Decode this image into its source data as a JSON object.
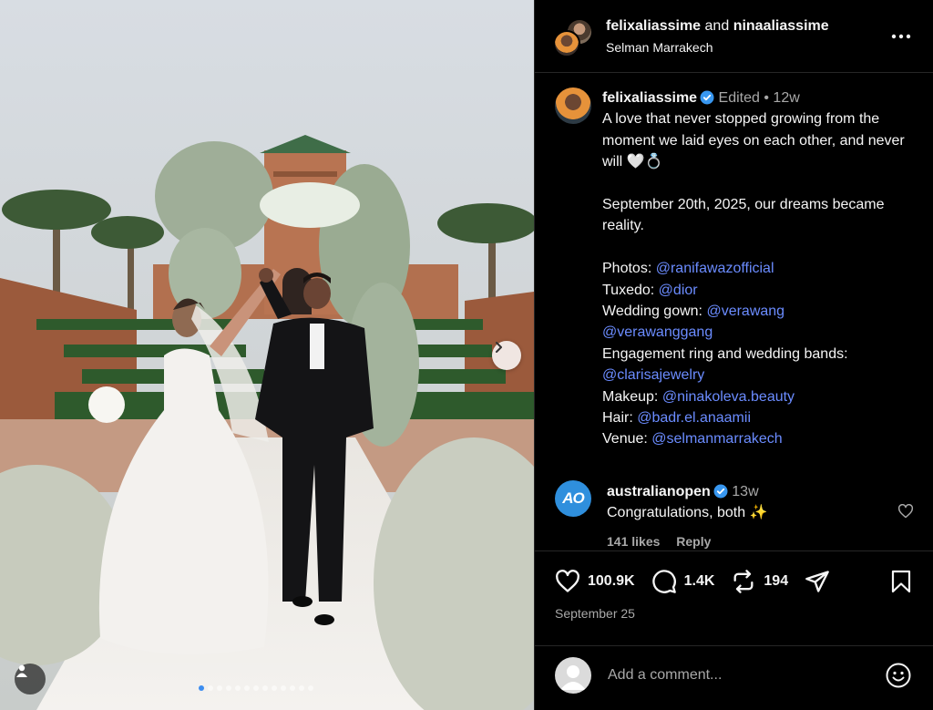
{
  "post": {
    "header": {
      "user1": "felixaliassime",
      "conjunction": "and",
      "user2": "ninaaliassime",
      "location": "Selman Marrakech"
    },
    "caption": {
      "username": "felixaliassime",
      "edited": "Edited",
      "separator": "•",
      "time": "12w",
      "line1": "A love that never stopped growing from the moment we laid eyes on each other, and never will 🤍💍",
      "line2": "September 20th, 2025, our dreams became reality.",
      "credits": [
        {
          "label": "Photos:",
          "handle": "@ranifawazofficial"
        },
        {
          "label": "Tuxedo:",
          "handle": "@dior"
        },
        {
          "label": "Wedding gown:",
          "handle": "@verawang",
          "handle2": "@verawanggang"
        },
        {
          "label": "Engagement ring and wedding bands:",
          "handle": "@clarisajewelry"
        },
        {
          "label": "Makeup:",
          "handle": "@ninakoleva.beauty"
        },
        {
          "label": "Hair:",
          "handle": "@badr.el.anaamii"
        },
        {
          "label": "Venue:",
          "handle": "@selmanmarrakech"
        }
      ]
    },
    "comment": {
      "avatar_text": "AO",
      "username": "australianopen",
      "time": "13w",
      "text": "Congratulations, both ✨",
      "likes": "141 likes",
      "reply": "Reply"
    },
    "actions": {
      "likes": "100.9K",
      "comments": "1.4K",
      "reposts": "194",
      "date": "September 25"
    },
    "add_comment": {
      "placeholder": "Add a comment..."
    },
    "carousel": {
      "total": 13,
      "active": 0
    },
    "icons": {
      "header_more": "more-horizontal-icon",
      "verified": "verified-badge-icon",
      "like": "heart-icon",
      "comment": "comment-bubble-icon",
      "repost": "repost-icon",
      "share": "send-icon",
      "save": "bookmark-icon",
      "emoji": "emoji-icon",
      "next": "chevron-right-icon",
      "tag": "user-tag-icon"
    },
    "colors": {
      "link": "#6b8cff",
      "verified": "#3897f0",
      "muted": "#a8a8a8",
      "background": "#000000"
    }
  }
}
